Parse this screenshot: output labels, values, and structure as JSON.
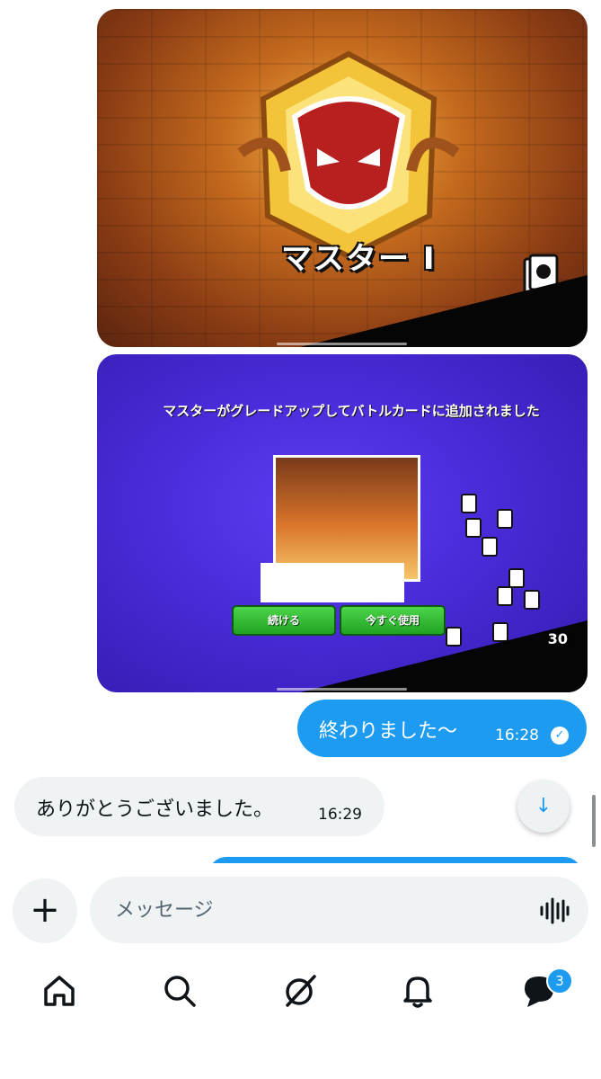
{
  "game_screens": {
    "rank_title": "マスター I",
    "upgrade_notice": "マスターがグレードアップしてバトルカードに追加されました",
    "continue_label": "続ける",
    "use_now_label": "今すぐ使用",
    "token_count": "30"
  },
  "messages": [
    {
      "direction": "outgoing",
      "text": "終わりました〜",
      "time": "16:28",
      "status": "read"
    },
    {
      "direction": "incoming",
      "text": "ありがとうございました。",
      "time": "16:29"
    }
  ],
  "composer": {
    "placeholder": "メッセージ",
    "add_icon": "plus-icon",
    "voice_icon": "voice-waveform-icon"
  },
  "tabbar": {
    "items": [
      {
        "name": "home",
        "icon": "home-icon"
      },
      {
        "name": "search",
        "icon": "search-icon"
      },
      {
        "name": "grok",
        "icon": "grok-icon"
      },
      {
        "name": "notifications",
        "icon": "bell-icon"
      },
      {
        "name": "messages",
        "icon": "chat-bubble-icon",
        "badge": "3"
      }
    ]
  },
  "colors": {
    "accent": "#1d9bf0",
    "incoming_bubble": "#eff3f4"
  }
}
